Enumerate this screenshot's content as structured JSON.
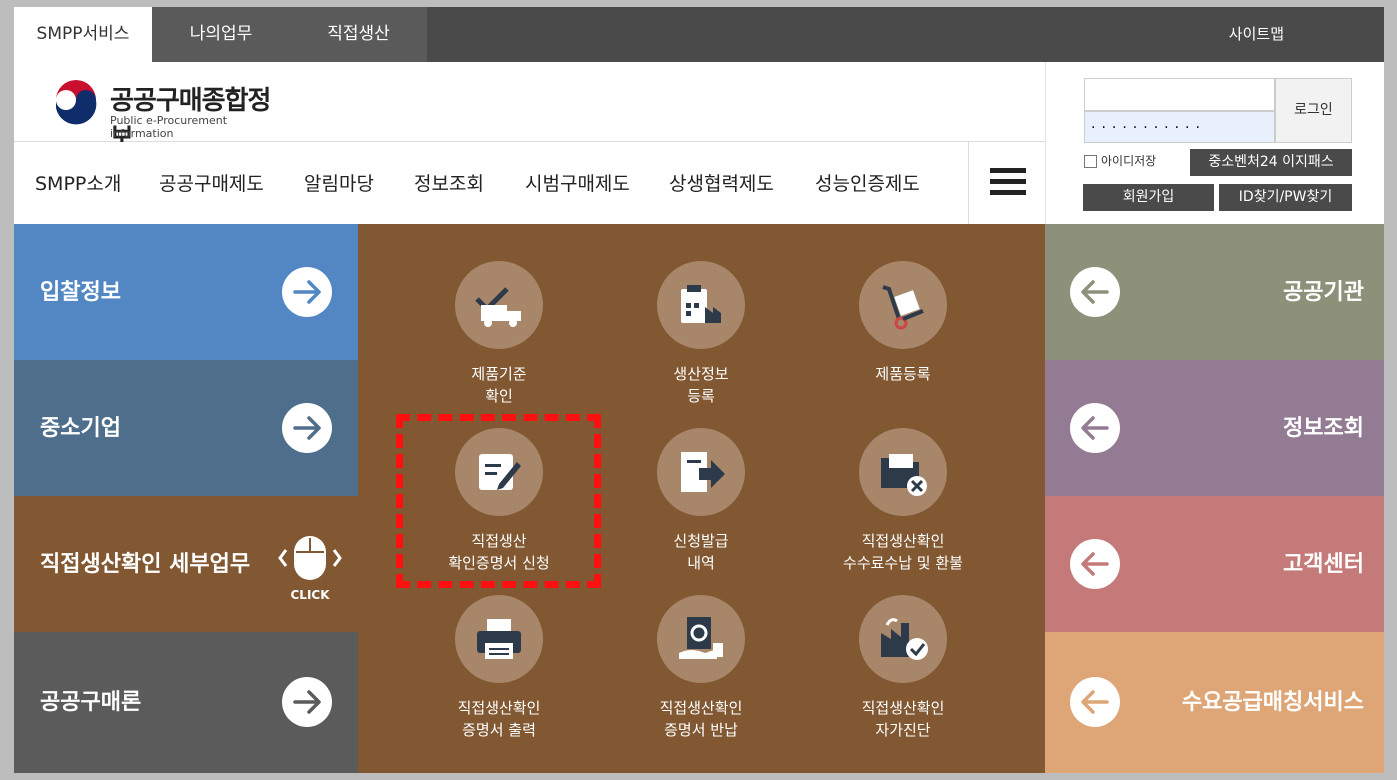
{
  "topbar": {
    "tabs": [
      {
        "label": "SMPP서비스",
        "active": true
      },
      {
        "label": "나의업무",
        "active": false
      },
      {
        "label": "직접생산",
        "active": false
      }
    ],
    "sitemap": "사이트맵"
  },
  "logo": {
    "title": "공공구매종합정보",
    "subtitle": "Public e-Procurement information"
  },
  "gnb": [
    "SMPP소개",
    "공공구매제도",
    "알림마당",
    "정보조회",
    "시범구매제도",
    "상생협력제도",
    "성능인증제도"
  ],
  "login": {
    "id_value": "",
    "pw_mask": "···········",
    "login_label": "로그인",
    "save_id_label": "아이디저장",
    "easy_pass_label": "중소벤처24 이지패스",
    "join_label": "회원가입",
    "find_label": "ID찾기/PW찾기"
  },
  "left_blocks": [
    {
      "label": "입찰정보",
      "color": "#5387c4"
    },
    {
      "label": "중소기업",
      "color": "#4f6e8c"
    },
    {
      "label": "직접생산확인 세부업무",
      "color": "#815832",
      "click": "CLICK"
    },
    {
      "label": "공공구매론",
      "color": "#5b5b5b"
    }
  ],
  "right_blocks": [
    {
      "label": "공공기관",
      "color": "#8d917a"
    },
    {
      "label": "정보조회",
      "color": "#947b94"
    },
    {
      "label": "고객센터",
      "color": "#c57a7a"
    },
    {
      "label": "수요공급매칭서비스",
      "color": "#dea577"
    }
  ],
  "services": [
    {
      "label": "제품기준\n확인",
      "icon": "truck-check-icon"
    },
    {
      "label": "생산정보\n등록",
      "icon": "factory-clipboard-icon"
    },
    {
      "label": "제품등록",
      "icon": "hand-truck-icon"
    },
    {
      "label": "직접생산\n확인증명서 신청",
      "icon": "document-edit-icon"
    },
    {
      "label": "신청발급\n내역",
      "icon": "document-export-icon"
    },
    {
      "label": "직접생산확인\n수수료수납 및 환불",
      "icon": "folder-cancel-icon"
    },
    {
      "label": "직접생산확인\n증명서 출력",
      "icon": "printer-icon"
    },
    {
      "label": "직접생산확인\n증명서 반납",
      "icon": "document-return-icon"
    },
    {
      "label": "직접생산확인\n자가진단",
      "icon": "factory-check-icon"
    }
  ]
}
